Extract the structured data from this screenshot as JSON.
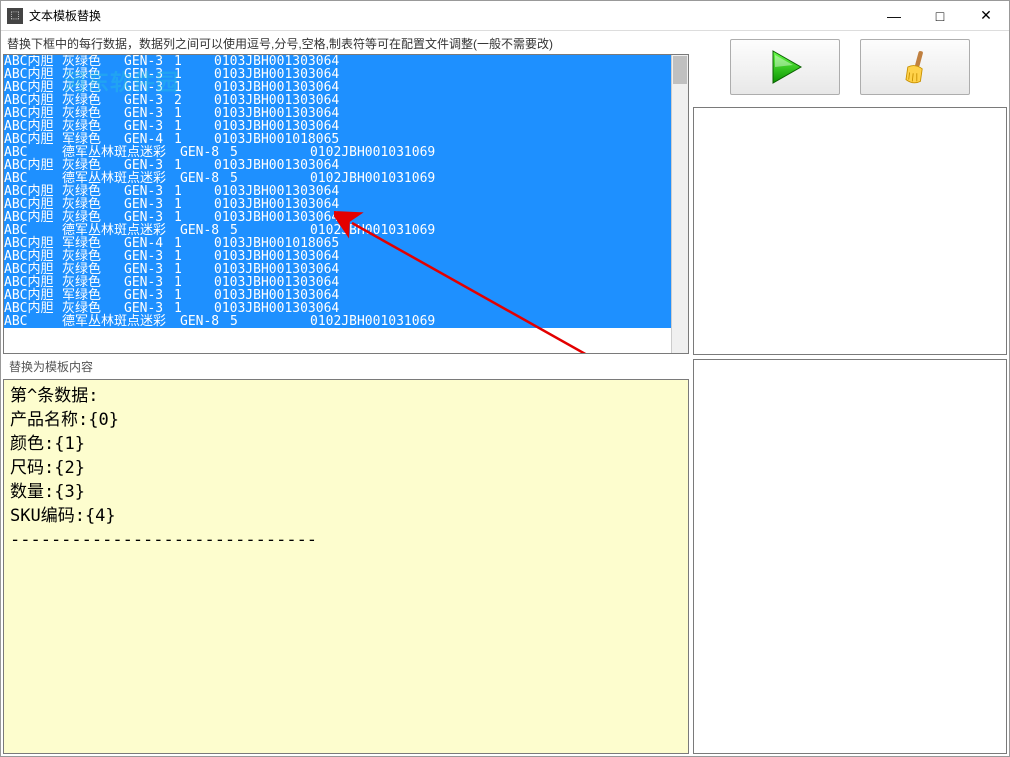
{
  "window": {
    "title": "文本模板替换",
    "minimize": "—",
    "maximize": "□",
    "close": "✕"
  },
  "watermark_top": "河东软件园",
  "watermark_url": "www.pc0359.cn",
  "instruction": "替换下框中的每行数据，数据列之间可以使用逗号,分号,空格,制表符等可在配置文件调整(一般不需要改)",
  "rows": [
    {
      "c0": "ABC内胆",
      "c1": "灰绿色",
      "c2": "GEN-3",
      "c3": "1",
      "c4": "0103JBH001303064",
      "wide": false
    },
    {
      "c0": "ABC内胆",
      "c1": "灰绿色",
      "c2": "GEN-3",
      "c3": "1",
      "c4": "0103JBH001303064",
      "wide": false
    },
    {
      "c0": "ABC内胆",
      "c1": "灰绿色",
      "c2": "GEN-3",
      "c3": "1",
      "c4": "0103JBH001303064",
      "wide": false
    },
    {
      "c0": "ABC内胆",
      "c1": "灰绿色",
      "c2": "GEN-3",
      "c3": "2",
      "c4": "0103JBH001303064",
      "wide": false
    },
    {
      "c0": "ABC内胆",
      "c1": "灰绿色",
      "c2": "GEN-3",
      "c3": "1",
      "c4": "0103JBH001303064",
      "wide": false
    },
    {
      "c0": "ABC内胆",
      "c1": "灰绿色",
      "c2": "GEN-3",
      "c3": "1",
      "c4": "0103JBH001303064",
      "wide": false
    },
    {
      "c0": "ABC内胆",
      "c1": "军绿色",
      "c2": "GEN-4",
      "c3": "1",
      "c4": "0103JBH001018065",
      "wide": false
    },
    {
      "c0": "ABC",
      "c1": "德军丛林斑点迷彩",
      "c2": "GEN-8",
      "c3": "5",
      "c4": "0102JBH001031069",
      "wide": true
    },
    {
      "c0": "ABC内胆",
      "c1": "灰绿色",
      "c2": "GEN-3",
      "c3": "1",
      "c4": "0103JBH001303064",
      "wide": false
    },
    {
      "c0": "ABC",
      "c1": "德军丛林斑点迷彩",
      "c2": "GEN-8",
      "c3": "5",
      "c4": "0102JBH001031069",
      "wide": true
    },
    {
      "c0": "ABC内胆",
      "c1": "灰绿色",
      "c2": "GEN-3",
      "c3": "1",
      "c4": "0103JBH001303064",
      "wide": false
    },
    {
      "c0": "ABC内胆",
      "c1": "灰绿色",
      "c2": "GEN-3",
      "c3": "1",
      "c4": "0103JBH001303064",
      "wide": false
    },
    {
      "c0": "ABC内胆",
      "c1": "灰绿色",
      "c2": "GEN-3",
      "c3": "1",
      "c4": "0103JBH001303064",
      "wide": false
    },
    {
      "c0": "ABC",
      "c1": "德军丛林斑点迷彩",
      "c2": "GEN-8",
      "c3": "5",
      "c4": "0102JBH001031069",
      "wide": true
    },
    {
      "c0": "ABC内胆",
      "c1": "军绿色",
      "c2": "GEN-4",
      "c3": "1",
      "c4": "0103JBH001018065",
      "wide": false
    },
    {
      "c0": "ABC内胆",
      "c1": "灰绿色",
      "c2": "GEN-3",
      "c3": "1",
      "c4": "0103JBH001303064",
      "wide": false
    },
    {
      "c0": "ABC内胆",
      "c1": "灰绿色",
      "c2": "GEN-3",
      "c3": "1",
      "c4": "0103JBH001303064",
      "wide": false
    },
    {
      "c0": "ABC内胆",
      "c1": "灰绿色",
      "c2": "GEN-3",
      "c3": "1",
      "c4": "0103JBH001303064",
      "wide": false
    },
    {
      "c0": "ABC内胆",
      "c1": "军绿色",
      "c2": "GEN-3",
      "c3": "1",
      "c4": "0103JBH001303064",
      "wide": false
    },
    {
      "c0": "ABC内胆",
      "c1": "灰绿色",
      "c2": "GEN-3",
      "c3": "1",
      "c4": "0103JBH001303064",
      "wide": false
    },
    {
      "c0": "ABC",
      "c1": "德军丛林斑点迷彩",
      "c2": "GEN-8",
      "c3": "5",
      "c4": "0102JBH001031069",
      "wide": true
    }
  ],
  "template_label": "替换为模板内容",
  "template_text": "第^条数据:\n产品名称:{0}\n颜色:{1}\n尺码:{2}\n数量:{3}\nSKU编码:{4}\n------------------------------",
  "toolbar": {
    "run": "run",
    "clear": "clear"
  }
}
